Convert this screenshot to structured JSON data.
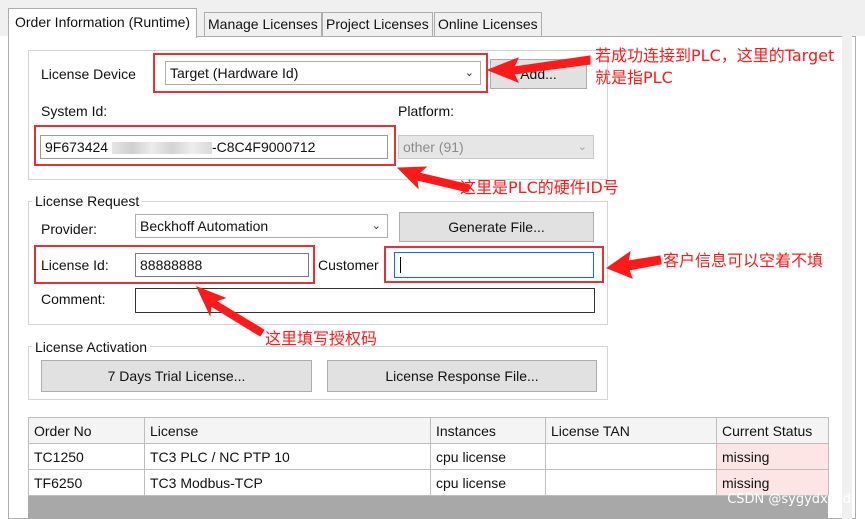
{
  "tabs": [
    {
      "label": "Order Information (Runtime)",
      "active": true
    },
    {
      "label": "Manage Licenses",
      "active": false
    },
    {
      "label": "Project Licenses",
      "active": false
    },
    {
      "label": "Online Licenses",
      "active": false
    }
  ],
  "device": {
    "label": "License Device",
    "selected": "Target (Hardware Id)",
    "add_label": "Add..."
  },
  "system": {
    "label": "System Id:",
    "id_prefix": "9F673424",
    "id_suffix": "-C8C4F9000712",
    "platform_label": "Platform:",
    "platform_value": "other (91)"
  },
  "request": {
    "title": "License Request",
    "provider_label": "Provider:",
    "provider_value": "Beckhoff Automation",
    "generate_label": "Generate File...",
    "license_id_label": "License Id:",
    "license_id_value": "88888888",
    "customer_label": "Customer",
    "customer_value": "",
    "comment_label": "Comment:",
    "comment_value": ""
  },
  "activation": {
    "title": "License Activation",
    "trial_label": "7 Days Trial License...",
    "response_label": "License Response File..."
  },
  "table": {
    "columns": [
      "Order No",
      "License",
      "Instances",
      "License TAN",
      "Current Status"
    ],
    "rows": [
      [
        "TC1250",
        "TC3 PLC / NC PTP 10",
        "cpu license",
        "",
        "missing"
      ],
      [
        "TF6250",
        "TC3 Modbus-TCP",
        "cpu license",
        "",
        "missing"
      ]
    ]
  },
  "annotations": {
    "device_note_line1": "若成功连接到PLC，这里的Target",
    "device_note_line2": "就是指PLC",
    "system_note": "这里是PLC的硬件ID号",
    "customer_note": "客户信息可以空着不填",
    "license_note": "这里填写授权码"
  },
  "watermark": "CSDN @sygydxfwd",
  "colors": {
    "annotation_red": "#e53238",
    "missing_bg": "#fde5e5",
    "focus_blue": "#0078d7"
  }
}
